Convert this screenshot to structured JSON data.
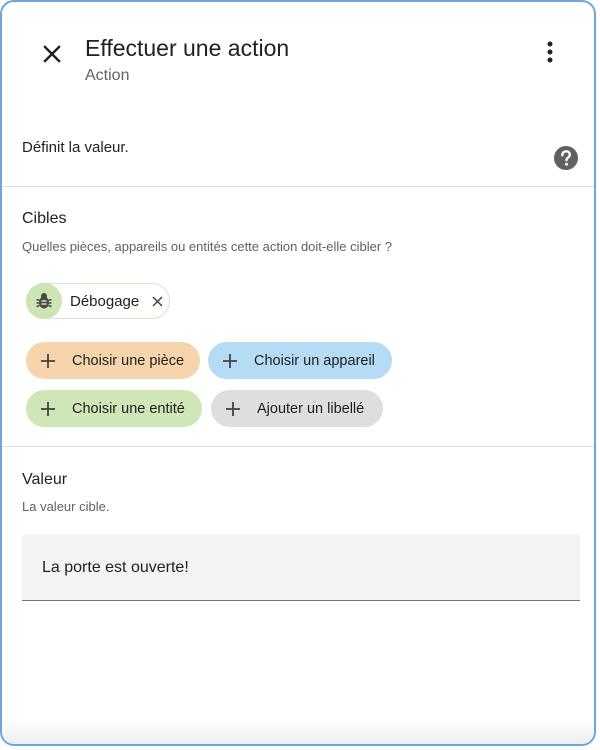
{
  "header": {
    "title": "Effectuer une action",
    "subtitle": "Action"
  },
  "action_description": "Définit la valeur.",
  "targets": {
    "title": "Cibles",
    "description": "Quelles pièces, appareils ou entités cette action doit-elle cibler ?",
    "selected": [
      {
        "label": "Débogage",
        "icon": "bug-icon"
      }
    ],
    "add_buttons": {
      "area": "Choisir une pièce",
      "device": "Choisir un appareil",
      "entity": "Choisir une entité",
      "label": "Ajouter un libellé"
    }
  },
  "value": {
    "title": "Valeur",
    "description": "La valeur cible.",
    "input_value": "La porte est ouverte!"
  },
  "icons": {
    "close": "close-icon",
    "more": "more-vert-icon",
    "help": "help-circle-icon",
    "chip_remove": "close-small-icon",
    "add": "plus-icon"
  },
  "colors": {
    "area_chip": "#f6d5ac",
    "device_chip": "#b5dcf4",
    "entity_chip": "#cfe6b6",
    "label_chip": "#dedede",
    "selected_chip_avatar": "#cde5b4",
    "dialog_border": "#6fa8d6"
  }
}
